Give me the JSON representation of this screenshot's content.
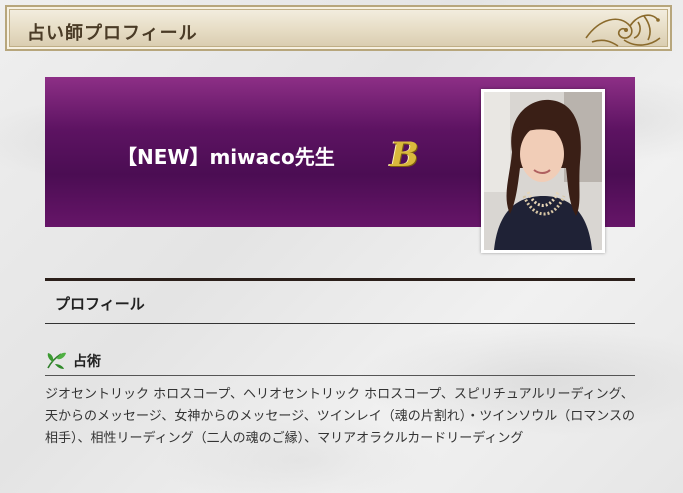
{
  "header": {
    "title": "占い師プロフィール",
    "ornament_icon": "gold-flourish-ornament"
  },
  "banner": {
    "name": "【NEW】miwaco先生",
    "rank_badge": "B",
    "background_color": "#5d1362",
    "badge_color": "#d9b93c"
  },
  "profile": {
    "heading": "プロフィール"
  },
  "skills": {
    "icon": "leaf-icon",
    "title": "占術",
    "text": "ジオセントリック ホロスコープ、ヘリオセントリック ホロスコープ、スピリチュアルリーディング、天からのメッセージ、女神からのメッセージ、ツインレイ（魂の片割れ）・ツインソウル（ロマンスの相手）、相性リーディング（二人の魂のご縁）、マリアオラクルカードリーディング"
  }
}
